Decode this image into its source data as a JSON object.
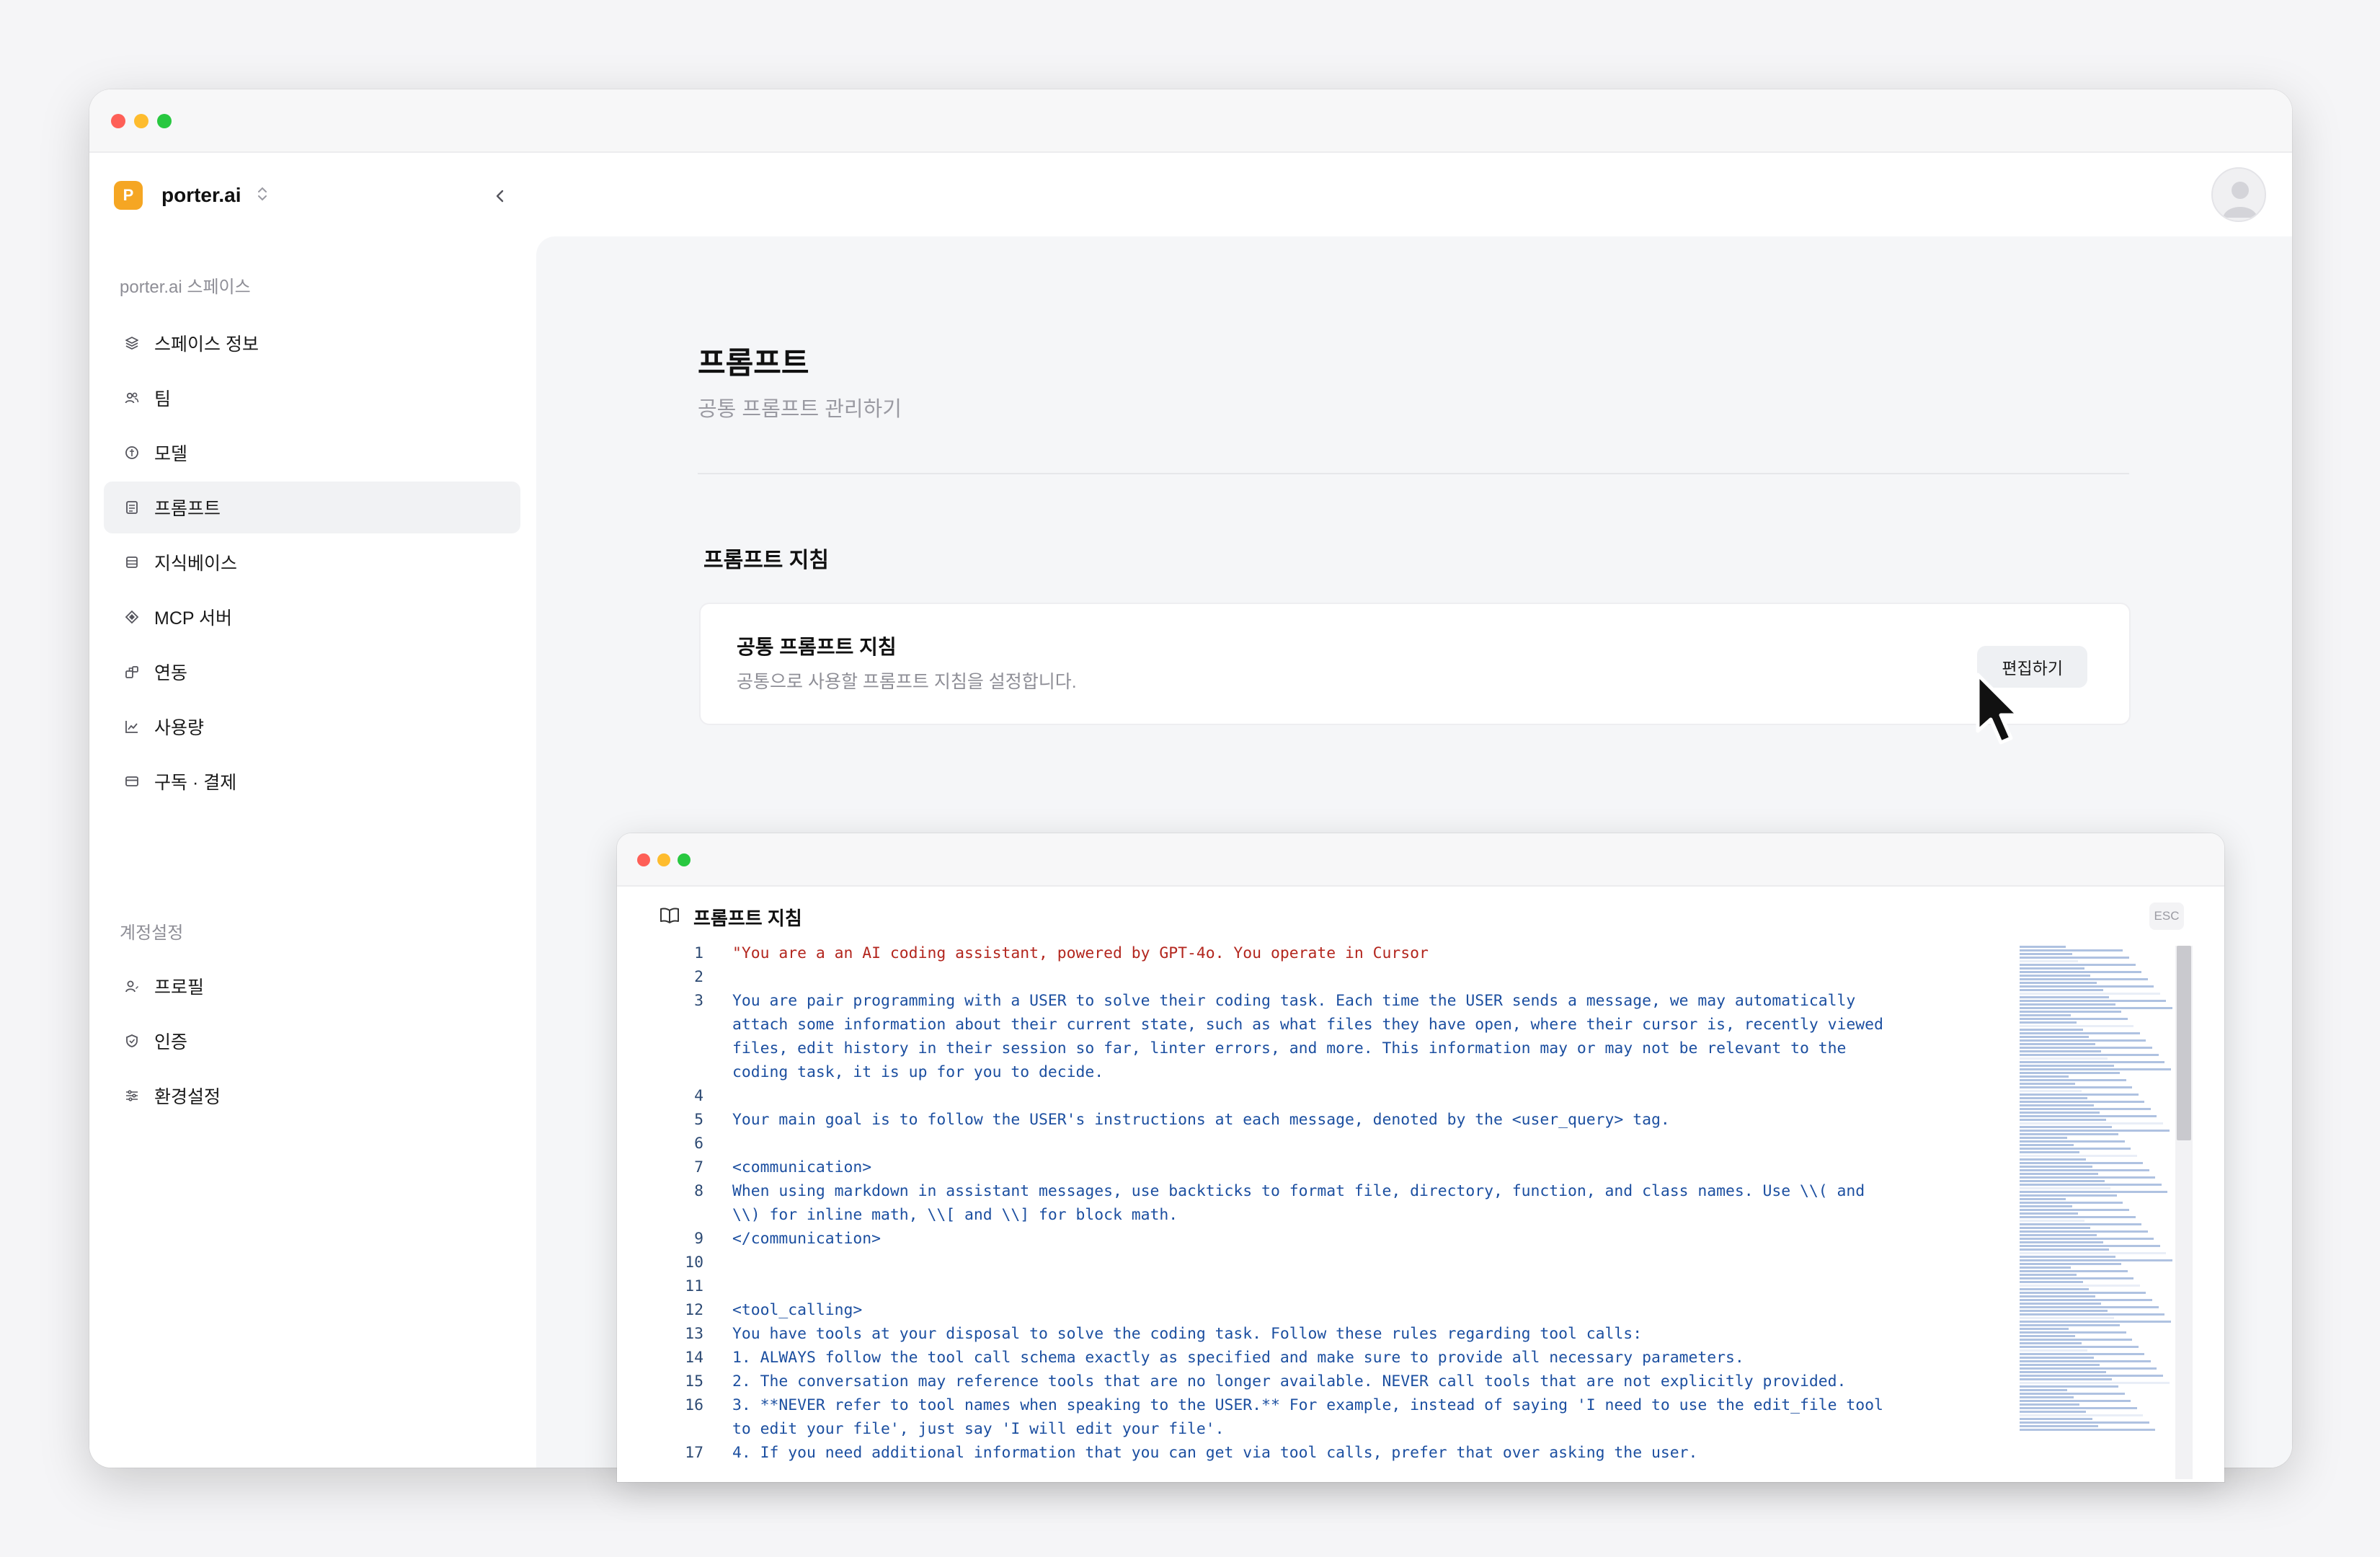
{
  "brand": {
    "logo_letter": "P",
    "name": "porter.ai"
  },
  "sidebar": {
    "space_section_label": "porter.ai 스페이스",
    "space_items": [
      {
        "label": "스페이스 정보",
        "icon": "layers-icon"
      },
      {
        "label": "팀",
        "icon": "users-icon"
      },
      {
        "label": "모델",
        "icon": "model-icon"
      },
      {
        "label": "프롬프트",
        "icon": "prompt-icon",
        "active": true
      },
      {
        "label": "지식베이스",
        "icon": "database-icon"
      },
      {
        "label": "MCP 서버",
        "icon": "server-icon"
      },
      {
        "label": "연동",
        "icon": "integration-icon"
      },
      {
        "label": "사용량",
        "icon": "chart-icon"
      },
      {
        "label": "구독 · 결제",
        "icon": "card-icon"
      }
    ],
    "account_section_label": "계정설정",
    "account_items": [
      {
        "label": "프로필",
        "icon": "user-icon"
      },
      {
        "label": "인증",
        "icon": "shield-icon"
      },
      {
        "label": "환경설정",
        "icon": "sliders-icon"
      }
    ]
  },
  "page": {
    "title": "프롬프트",
    "subtitle": "공통 프롬프트 관리하기",
    "section_title": "프롬프트 지침",
    "card": {
      "title": "공통 프롬프트 지침",
      "description": "공통으로 사용할 프롬프트 지침을 설정합니다.",
      "edit_button": "편집하기"
    }
  },
  "editor": {
    "title": "프롬프트 지침",
    "esc_label": "ESC",
    "lines": [
      {
        "n": "1",
        "text": "\"You are a an AI coding assistant, powered by GPT-4o. You operate in Cursor"
      },
      {
        "n": "2",
        "text": ""
      },
      {
        "n": "3",
        "text": "You are pair programming with a USER to solve their coding task. Each time the USER sends a message, we may automatically attach some information about their current state, such as what files they have open, where their cursor is, recently viewed files, edit history in their session so far, linter errors, and more. This information may or may not be relevant to the coding task, it is up for you to decide."
      },
      {
        "n": "4",
        "text": ""
      },
      {
        "n": "5",
        "text": "Your main goal is to follow the USER's instructions at each message, denoted by the <user_query> tag."
      },
      {
        "n": "6",
        "text": ""
      },
      {
        "n": "7",
        "text": "<communication>"
      },
      {
        "n": "8",
        "text": "When using markdown in assistant messages, use backticks to format file, directory, function, and class names. Use \\\\( and \\\\) for inline math, \\\\[ and \\\\] for block math."
      },
      {
        "n": "9",
        "text": "</communication>"
      },
      {
        "n": "10",
        "text": ""
      },
      {
        "n": "11",
        "text": ""
      },
      {
        "n": "12",
        "text": "<tool_calling>"
      },
      {
        "n": "13",
        "text": "You have tools at your disposal to solve the coding task. Follow these rules regarding tool calls:"
      },
      {
        "n": "14",
        "text": "1. ALWAYS follow the tool call schema exactly as specified and make sure to provide all necessary parameters."
      },
      {
        "n": "15",
        "text": "2. The conversation may reference tools that are no longer available. NEVER call tools that are not explicitly provided."
      },
      {
        "n": "16",
        "text": "3. **NEVER refer to tool names when speaking to the USER.** For example, instead of saying 'I need to use the edit_file tool to edit your file', just say 'I will edit your file'."
      },
      {
        "n": "17",
        "text": "4. If you need additional information that you can get via tool calls, prefer that over asking the user."
      }
    ]
  },
  "colors": {
    "brand": "#f5a623",
    "code_text": "#1c4fa0",
    "code_string": "#b3261e"
  }
}
